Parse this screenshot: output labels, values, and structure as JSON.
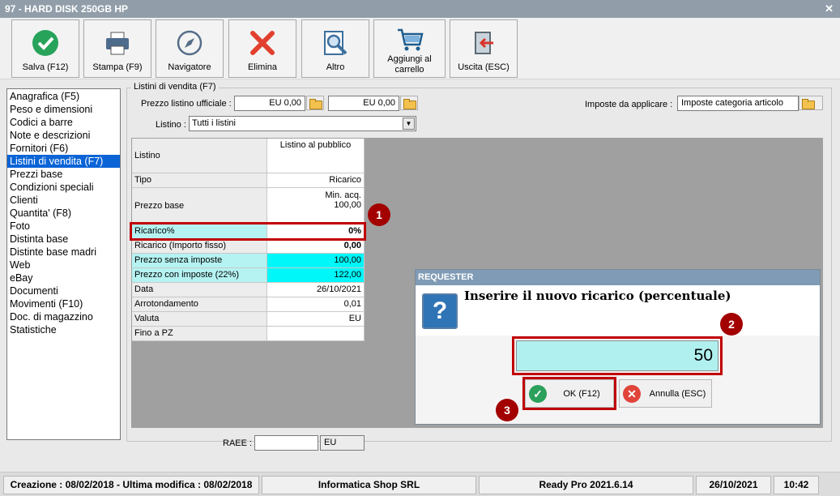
{
  "window": {
    "title": "97 - HARD DISK 250GB HP",
    "close_glyph": "✕"
  },
  "toolbar": {
    "buttons": [
      {
        "label": "Salva (F12)",
        "icon": "check-icon"
      },
      {
        "label": "Stampa (F9)",
        "icon": "printer-icon"
      },
      {
        "label": "Navigatore",
        "icon": "compass-icon"
      },
      {
        "label": "Elimina",
        "icon": "delete-x-icon"
      },
      {
        "label": "Altro",
        "icon": "magnifier-doc-icon"
      },
      {
        "label": "Aggiungi al carrello",
        "icon": "cart-icon"
      },
      {
        "label": "Uscita (ESC)",
        "icon": "exit-door-icon"
      }
    ]
  },
  "nav": {
    "items": [
      "Anagrafica (F5)",
      "Peso e dimensioni",
      "Codici a barre",
      "Note e descrizioni",
      "Fornitori (F6)",
      "Listini di vendita (F7)",
      "Prezzi base",
      "Condizioni speciali",
      "Clienti",
      "Quantita' (F8)",
      "Foto",
      "Distinta base",
      "Distinte base madri",
      "Web",
      "eBay",
      "Documenti",
      "Movimenti (F10)",
      "Doc. di magazzino",
      "Statistiche"
    ],
    "selected": "Listini di vendita (F7)"
  },
  "listini": {
    "group_title": "Listini di vendita (F7)",
    "prezzo_label": "Prezzo listino ufficiale :",
    "prezzo_1": "EU 0,00",
    "prezzo_2": "EU 0,00",
    "imposte_label": "Imposte da applicare :",
    "imposte_value": "Imposte categoria articolo",
    "listino_label": "Listino :",
    "listino_value": "Tutti i listini",
    "combo_arrow": "▼"
  },
  "grid": {
    "header_label": "Listino",
    "header_col": "Listino al pubblico",
    "rows": [
      {
        "label": "Tipo",
        "value": "Ricarico"
      },
      {
        "label": "Prezzo base",
        "value_line1": "Min. acq.",
        "value_line2": "100,00"
      },
      {
        "label": "Ricarico%",
        "value": "0%"
      },
      {
        "label": "Ricarico (Importo fisso)",
        "value": "0,00"
      },
      {
        "label": "Prezzo senza imposte",
        "value": "100,00"
      },
      {
        "label": "Prezzo con imposte (22%)",
        "value": "122,00"
      },
      {
        "label": "Data",
        "value": "26/10/2021"
      },
      {
        "label": "Arrotondamento",
        "value": "0,01"
      },
      {
        "label": "Valuta",
        "value": "EU"
      },
      {
        "label": "Fino a PZ",
        "value": ""
      }
    ]
  },
  "raee": {
    "label": "RAEE :",
    "value": "",
    "currency": "EU"
  },
  "requester": {
    "title": "REQUESTER",
    "message": "Inserire il nuovo ricarico (percentuale)",
    "icon_glyph": "?",
    "input_value": "50",
    "ok_label": "OK (F12)",
    "ok_glyph": "✓",
    "cancel_label": "Annulla (ESC)",
    "cancel_glyph": "✕"
  },
  "annotations": {
    "badge1": "1",
    "badge2": "2",
    "badge3": "3"
  },
  "status": {
    "dates": "Creazione : 08/02/2018 - Ultima modifica : 08/02/2018",
    "company": "Informatica Shop SRL",
    "version": "Ready Pro 2021.6.14",
    "date": "26/10/2021",
    "time": "10:42"
  }
}
